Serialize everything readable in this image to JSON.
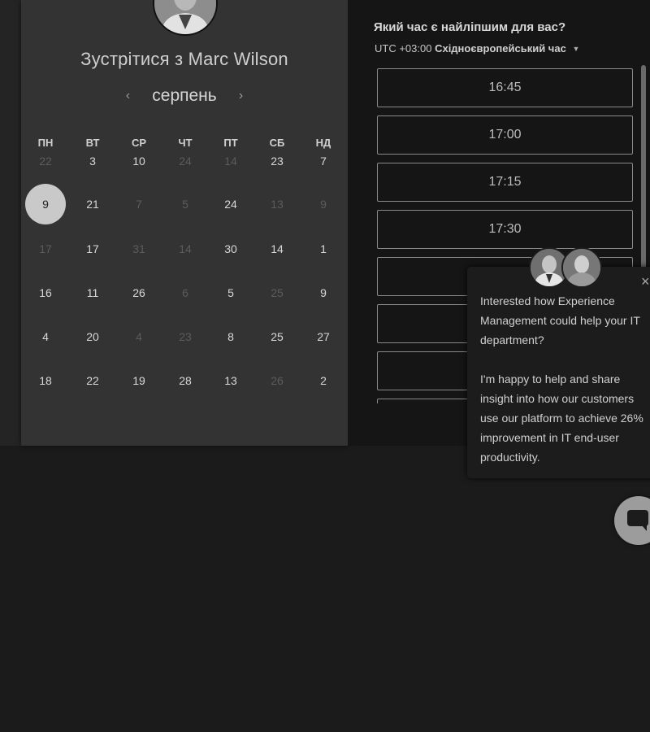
{
  "booking": {
    "title": "Зустрітися з Marc Wilson",
    "month": "серпень",
    "prev_icon": "chevron-left-icon",
    "next_icon": "chevron-right-icon",
    "weekdays": [
      "ПН",
      "ВТ",
      "СР",
      "ЧТ",
      "ПТ",
      "СБ",
      "НД"
    ],
    "weeks": [
      [
        "22",
        "3",
        "10",
        "24",
        "14",
        "23",
        "7"
      ],
      [
        "9",
        "21",
        "7",
        "5",
        "24",
        "13",
        "9"
      ],
      [
        "17",
        "17",
        "31",
        "14",
        "30",
        "14",
        "1"
      ],
      [
        "16",
        "11",
        "26",
        "6",
        "5",
        "25",
        "9"
      ],
      [
        "4",
        "20",
        "4",
        "23",
        "8",
        "25",
        "27"
      ],
      [
        "18",
        "22",
        "19",
        "28",
        "13",
        "26",
        "2"
      ]
    ],
    "selected_day": "9"
  },
  "times": {
    "question": "Який час є найліпшим для вас?",
    "timezone_offset": "UTC +03:00",
    "timezone_name": "Східноєвропейський час",
    "slots": [
      "16:45",
      "17:00",
      "17:15",
      "17:30",
      "",
      "",
      "",
      ""
    ]
  },
  "chat": {
    "paragraph1": "Interested how Experience Management could help your IT department?",
    "paragraph2": "I'm happy to help and share insight into how our customers use our platform to achieve 26% improvement in IT end-user productivity.",
    "close_label": "×",
    "launcher_icon": "chat-bubble-icon"
  }
}
